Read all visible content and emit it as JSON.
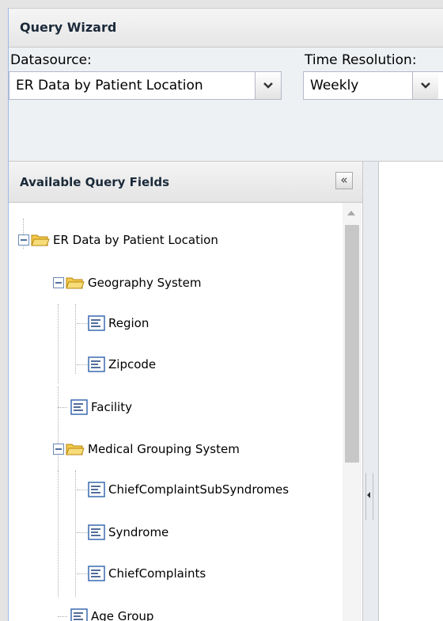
{
  "wizard": {
    "title": "Query Wizard"
  },
  "form": {
    "datasource_label": "Datasource:",
    "datasource_value": "ER Data by Patient Location",
    "resolution_label": "Time Resolution:",
    "resolution_value": "Weekly"
  },
  "fields_panel": {
    "title": "Available Query Fields",
    "collapse_label": "«",
    "tree": [
      {
        "label": "ER Data by Patient Location",
        "type": "folder",
        "state": "expanded",
        "level": 0
      },
      {
        "label": "Geography System",
        "type": "folder",
        "state": "expanded",
        "level": 1
      },
      {
        "label": "Region",
        "type": "field",
        "level": 2
      },
      {
        "label": "Zipcode",
        "type": "field",
        "level": 2
      },
      {
        "label": "Facility",
        "type": "field",
        "level": 1
      },
      {
        "label": "Medical Grouping System",
        "type": "folder",
        "state": "expanded",
        "level": 1
      },
      {
        "label": "ChiefComplaintSubSyndromes",
        "type": "field",
        "level": 2
      },
      {
        "label": "Syndrome",
        "type": "field",
        "level": 2
      },
      {
        "label": "ChiefComplaints",
        "type": "field",
        "level": 2
      },
      {
        "label": "Age Group",
        "type": "field",
        "level": 1
      }
    ]
  },
  "colors": {
    "border_accent": "#99bbe8",
    "folder": "#f2c94c",
    "field_icon": "#3a6ab0"
  }
}
